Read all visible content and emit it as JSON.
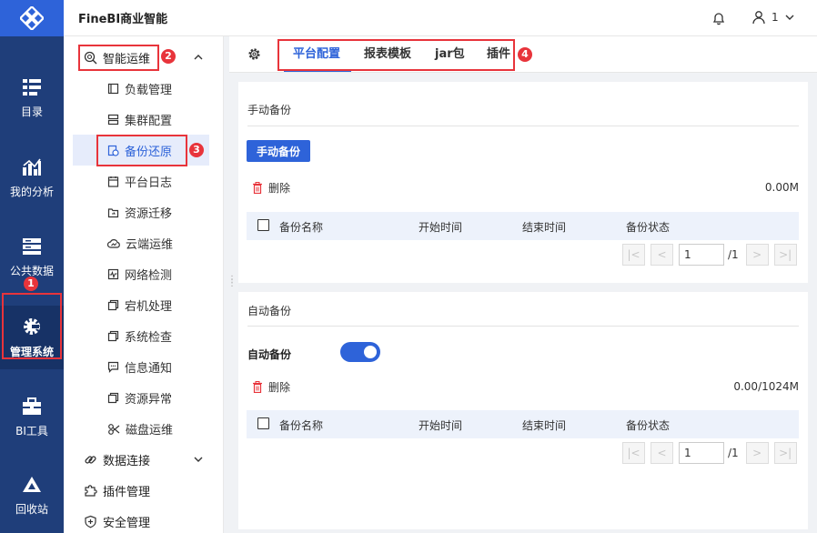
{
  "app": {
    "title": "FineBI商业智能"
  },
  "user": {
    "label": "1"
  },
  "rail": {
    "items": [
      {
        "label": "目录",
        "icon": "catalog-icon"
      },
      {
        "label": "我的分析",
        "icon": "analysis-icon"
      },
      {
        "label": "公共数据",
        "icon": "database-icon"
      },
      {
        "label": "管理系统",
        "icon": "gear-icon",
        "active": true
      },
      {
        "label": "BI工具",
        "icon": "toolbox-icon"
      },
      {
        "label": "回收站",
        "icon": "recycle-icon"
      }
    ]
  },
  "menu": {
    "group_ops": "智能运维",
    "items": [
      "负载管理",
      "集群配置",
      "备份还原",
      "平台日志",
      "资源迁移",
      "云端运维",
      "网络检测",
      "宕机处理",
      "系统检查",
      "信息通知",
      "资源异常",
      "磁盘运维"
    ],
    "active_item": "备份还原",
    "group_data": "数据连接",
    "plugin_mgmt": "插件管理",
    "security_mgmt": "安全管理"
  },
  "tabs": [
    "平台配置",
    "报表模板",
    "jar包",
    "插件"
  ],
  "manual": {
    "title": "手动备份",
    "button": "手动备份",
    "delete": "删除",
    "size": "0.00M",
    "columns": [
      "备份名称",
      "开始时间",
      "结束时间",
      "备份状态"
    ],
    "page_value": "1",
    "page_total": "/1"
  },
  "auto": {
    "title": "自动备份",
    "toggle_label": "自动备份",
    "toggle_on": true,
    "delete": "删除",
    "size": "0.00/1024M",
    "columns": [
      "备份名称",
      "开始时间",
      "结束时间",
      "备份状态"
    ],
    "page_value": "1",
    "page_total": "/1"
  },
  "markers": [
    "1",
    "2",
    "3",
    "4"
  ],
  "colors": {
    "rail_bg": "#1f3e7a",
    "accent": "#2e63d9",
    "annotation": "#e8343b",
    "delete_icon": "#e8343b"
  }
}
